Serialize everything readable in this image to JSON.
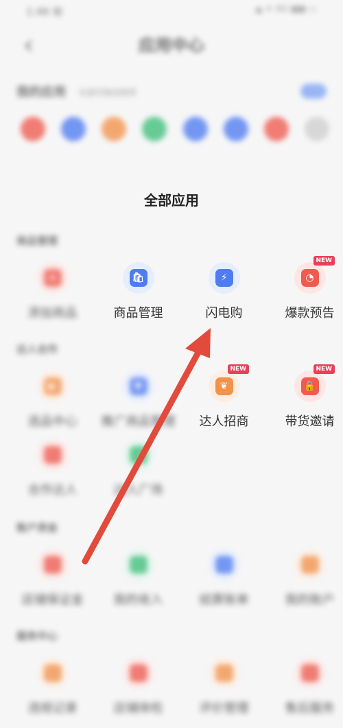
{
  "status": {
    "left": "1:46 ㊙",
    "right": "▲ ✦ 4G ▮▮▮ ▭"
  },
  "header": {
    "title": "应用中心",
    "back": "‹"
  },
  "favorites": {
    "title": "我的应用",
    "subtitle": "长按可拖动排序",
    "colors": [
      "#f05a4f",
      "#4f7cf2",
      "#f3924a",
      "#3fbf7a",
      "#4f7cf2",
      "#4f7cf2",
      "#f05a4f",
      "#cfcfcf"
    ]
  },
  "all_apps": {
    "title": "全部应用"
  },
  "sections": [
    {
      "label": "商品管理",
      "items": [
        {
          "label": "添加商品",
          "blurred": true,
          "bg": "#fde6e3",
          "color": "#f05a4f",
          "glyph": "+"
        },
        {
          "label": "商品管理",
          "blurred": false,
          "bg": "#e6edfd",
          "color": "#4f7cf2",
          "glyph": "🛍"
        },
        {
          "label": "闪电购",
          "blurred": false,
          "bg": "#e6edfd",
          "color": "#4f7cf2",
          "glyph": "⚡"
        },
        {
          "label": "爆款预告",
          "blurred": false,
          "bg": "#fde6e3",
          "color": "#f05a4f",
          "glyph": "◔",
          "badge": "NEW"
        }
      ]
    },
    {
      "label": "达人合作",
      "items": [
        {
          "label": "选品中心",
          "blurred": true,
          "bg": "#fdeee3",
          "color": "#f3924a",
          "glyph": "▶"
        },
        {
          "label": "推广商品管理",
          "blurred": true,
          "bg": "#e6edfd",
          "color": "#4f7cf2",
          "glyph": "▼"
        },
        {
          "label": "达人招商",
          "blurred": false,
          "bg": "#fdeee3",
          "color": "#f3924a",
          "glyph": "❦",
          "badge": "NEW"
        },
        {
          "label": "带货邀请",
          "blurred": false,
          "bg": "#fde6e3",
          "color": "#f05a4f",
          "glyph": "🔒",
          "badge": "NEW"
        }
      ]
    }
  ],
  "section_extra": [
    {
      "label": "合作达人",
      "bg": "#fde6e3",
      "color": "#f05a4f"
    },
    {
      "label": "达人广场",
      "bg": "#e3f6ec",
      "color": "#3fbf7a"
    }
  ],
  "section3": {
    "label": "账户资金",
    "items": [
      {
        "label": "店铺保证金",
        "bg": "#fde6e3",
        "color": "#f05a4f"
      },
      {
        "label": "我的收入",
        "bg": "#e3f6ec",
        "color": "#3fbf7a"
      },
      {
        "label": "结算账单",
        "bg": "#e6edfd",
        "color": "#4f7cf2"
      },
      {
        "label": "我的账户",
        "bg": "#fdeee3",
        "color": "#f3924a"
      }
    ]
  },
  "section4": {
    "label": "服务中心",
    "items": [
      {
        "label": "违规记录",
        "bg": "#fdeee3",
        "color": "#f3924a"
      },
      {
        "label": "店铺体检",
        "bg": "#fde6e3",
        "color": "#f05a4f"
      },
      {
        "label": "评价管理",
        "bg": "#fdeee3",
        "color": "#f3924a"
      },
      {
        "label": "售后服务",
        "bg": "#fde6e3",
        "color": "#f05a4f"
      }
    ]
  },
  "annotation": {
    "arrow_color": "#e24a3b"
  }
}
